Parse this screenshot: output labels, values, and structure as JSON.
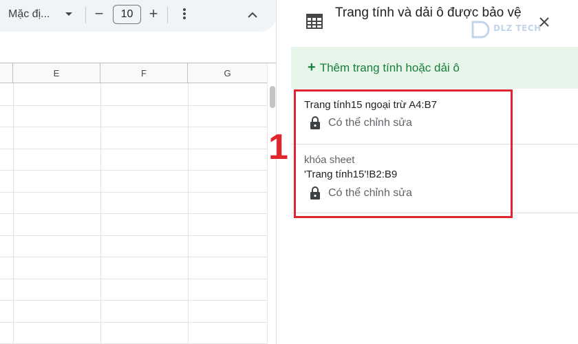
{
  "toolbar": {
    "font_name": "Mặc đị...",
    "font_size": "10",
    "minus_label": "−",
    "plus_label": "+"
  },
  "columns": [
    "E",
    "F",
    "G"
  ],
  "panel": {
    "title": "Trang tính và dải ô được bảo vệ",
    "add_label": "Thêm trang tính hoặc dải ô",
    "watermark": "DLZ TECH",
    "items": [
      {
        "title": "Trang tính15 ngoại trừ A4:B7",
        "desc": "",
        "permission": "Có thể chỉnh sửa"
      },
      {
        "title": "'Trang tính15'!B2:B9",
        "desc": "khóa sheet",
        "permission": "Có thể chỉnh sửa"
      }
    ]
  },
  "annotation": {
    "number": "1",
    "color": "#e0252e"
  },
  "colors": {
    "accent_green": "#188038",
    "green_bg": "#e6f4ea",
    "highlight_red": "#e0252e"
  }
}
